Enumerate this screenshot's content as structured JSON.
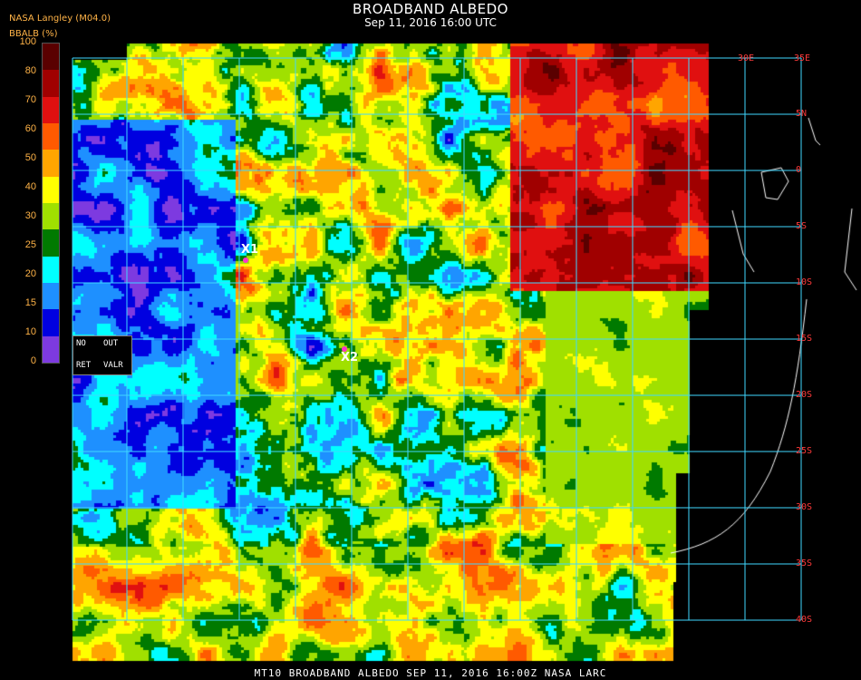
{
  "header": {
    "title": "BROADBAND ALBEDO",
    "subtitle": "Sep 11, 2016 16:00 UTC",
    "producer": "NASA Langley (M04.0)",
    "unit_label": "BBALB (%)"
  },
  "legend": {
    "ticks": [
      "100",
      "80",
      "70",
      "60",
      "50",
      "40",
      "30",
      "25",
      "20",
      "15",
      "10",
      "0"
    ],
    "bands": [
      {
        "color": "#5a0000"
      },
      {
        "color": "#a00000"
      },
      {
        "color": "#e01010"
      },
      {
        "color": "#ff5a00"
      },
      {
        "color": "#ffa500"
      },
      {
        "color": "#ffff00"
      },
      {
        "color": "#a0e000"
      },
      {
        "color": "#007a00"
      },
      {
        "color": "#00ffff"
      },
      {
        "color": "#1e90ff"
      },
      {
        "color": "#0000e0"
      },
      {
        "color": "#7d3ae0"
      }
    ]
  },
  "status_box": {
    "no": "NO",
    "out": "OUT",
    "ret": "RET",
    "valr": "VALR"
  },
  "map": {
    "lat_labels": [
      "5N",
      "0",
      "5S",
      "10S",
      "15S",
      "20S",
      "25S",
      "30S",
      "35S",
      "40S"
    ],
    "top_labels": [
      "30E",
      "35E"
    ],
    "markers": [
      {
        "label": "X1",
        "color": "#ff33cc"
      },
      {
        "label": "X2",
        "color": "#ff33cc"
      }
    ]
  },
  "footer": {
    "caption": "MT10   BROADBAND ALBEDO   SEP 11, 2016 16:00Z   NASA LARC"
  }
}
